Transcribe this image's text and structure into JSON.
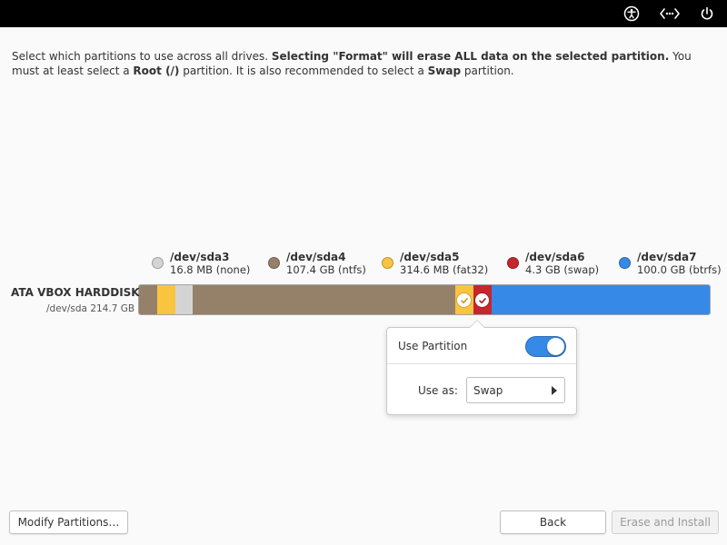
{
  "intro": {
    "part1": "Select which partitions to use across all drives. ",
    "bold1": "Selecting \"Format\" will erase ALL data on the selected partition.",
    "part2": " You must at least select a ",
    "bold2": "Root (/)",
    "part3": " partition. It is also recommended to select a ",
    "bold3": "Swap",
    "part4": " partition."
  },
  "top_icons": [
    "accessibility-icon",
    "network-icon",
    "power-icon"
  ],
  "legend": [
    {
      "name": "/dev/sda3",
      "info": "16.8 MB (none)",
      "color": "#d4d4d4"
    },
    {
      "name": "/dev/sda4",
      "info": "107.4 GB (ntfs)",
      "color": "#95816a"
    },
    {
      "name": "/dev/sda5",
      "info": "314.6 MB (fat32)",
      "color": "#f9c440"
    },
    {
      "name": "/dev/sda6",
      "info": "4.3 GB (swap)",
      "color": "#c6262e"
    },
    {
      "name": "/dev/sda7",
      "info": "100.0 GB (btrfs)",
      "color": "#3689e6"
    }
  ],
  "disk": {
    "title": "ATA VBOX HARDDISK",
    "subtitle": "/dev/sda 214.7 GB"
  },
  "popover": {
    "use_partition_label": "Use Partition",
    "use_partition_on": true,
    "use_as_label": "Use as:",
    "use_as_value": "Swap"
  },
  "buttons": {
    "modify": "Modify Partitions…",
    "back": "Back",
    "erase": "Erase and Install"
  }
}
